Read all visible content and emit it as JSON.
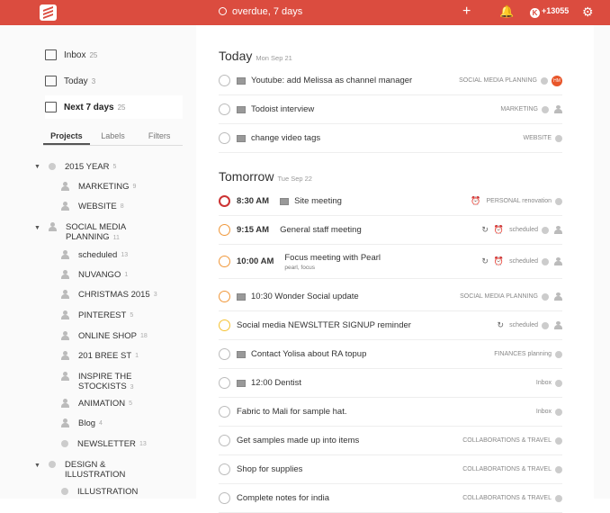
{
  "topbar": {
    "search_placeholder": "overdue, 7 days",
    "karma": "+13055",
    "karma_icon": "K",
    "colors": {
      "brand": "#db4c3f"
    }
  },
  "nav": [
    {
      "label": "Inbox",
      "count": "25"
    },
    {
      "label": "Today",
      "count": "3"
    },
    {
      "label": "Next 7 days",
      "count": "25",
      "active": true
    }
  ],
  "tabs": [
    "Projects",
    "Labels",
    "Filters"
  ],
  "projects": [
    {
      "label": "2015 YEAR",
      "count": "5"
    },
    {
      "label": "MARKETING",
      "count": "9"
    },
    {
      "label": "WEBSITE",
      "count": "8"
    },
    {
      "label": "SOCIAL MEDIA PLANNING",
      "count": "11"
    },
    {
      "label": "scheduled",
      "count": "13"
    },
    {
      "label": "NUVANGO",
      "count": "1"
    },
    {
      "label": "CHRISTMAS 2015",
      "count": "3"
    },
    {
      "label": "PINTEREST",
      "count": "5"
    },
    {
      "label": "ONLINE SHOP",
      "count": "18"
    },
    {
      "label": "201 BREE ST",
      "count": "1"
    },
    {
      "label": "INSPIRE THE STOCKISTS",
      "count": "3"
    },
    {
      "label": "ANIMATION",
      "count": "5"
    },
    {
      "label": "Blog",
      "count": "4"
    },
    {
      "label": "NEWSLETTER",
      "count": "13"
    },
    {
      "label": "DESIGN & ILLUSTRATION",
      "count": ""
    },
    {
      "label": "ILLUSTRATION",
      "count": ""
    }
  ],
  "today": {
    "title": "Today",
    "date": "Mon Sep 21",
    "tasks": [
      {
        "text": "Youtube: add Melissa as channel manager",
        "project": "SOCIAL MEDIA PLANNING",
        "avatar": "HM"
      },
      {
        "text": "Todoist interview",
        "project": "MARKETING"
      },
      {
        "text": "change video tags",
        "project": "WEBSITE"
      }
    ]
  },
  "tomorrow": {
    "title": "Tomorrow",
    "date": "Tue Sep 22",
    "tasks": [
      {
        "time": "8:30 AM",
        "text": "Site meeting",
        "project": "PERSONAL renovation"
      },
      {
        "time": "9:15 AM",
        "text": "General staff meeting",
        "project": "scheduled"
      },
      {
        "time": "10:00 AM",
        "text": "Focus meeting with Pearl",
        "labels": "pearl, focus",
        "project": "scheduled"
      },
      {
        "text": "10:30 Wonder Social update",
        "project": "SOCIAL MEDIA PLANNING"
      },
      {
        "text": "Social media NEWSLTTER SIGNUP reminder",
        "project": "scheduled"
      },
      {
        "text": "Contact Yolisa about RA topup",
        "project": "FINANCES planning"
      },
      {
        "text": "12:00 Dentist",
        "project": "Inbox"
      },
      {
        "text": "Fabric to Mali for sample hat.",
        "project": "Inbox"
      },
      {
        "text": "Get samples made up into items",
        "project": "COLLABORATIONS & TRAVEL"
      },
      {
        "text": "Shop for supplies",
        "project": "COLLABORATIONS & TRAVEL"
      },
      {
        "text": "Complete notes for india",
        "project": "COLLABORATIONS & TRAVEL"
      }
    ]
  }
}
